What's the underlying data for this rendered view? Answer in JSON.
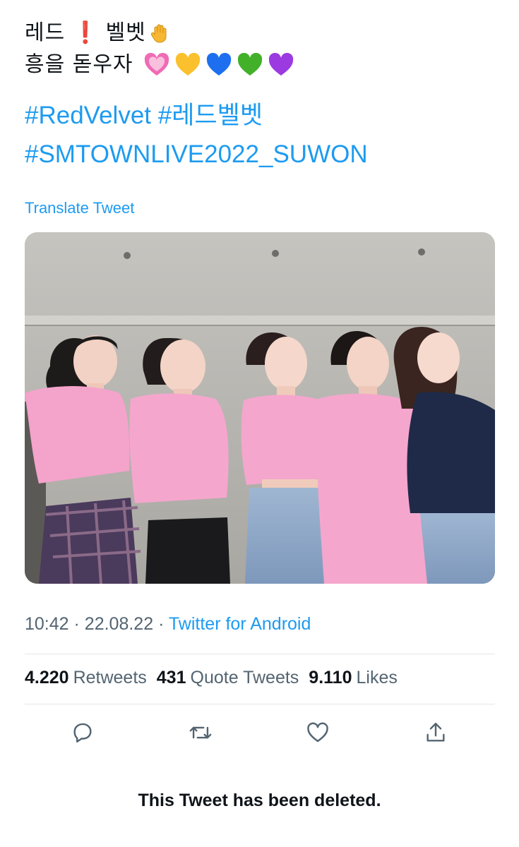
{
  "tweet": {
    "line1_part1": "레드",
    "line1_part2": "벨벳",
    "line2": "흥을 돋우자",
    "hashtags_line1": [
      "#RedVelvet",
      "#레드벨벳"
    ],
    "hashtags_line2": [
      "#SMTOWNLIVE2022_SUWON"
    ],
    "translate_label": "Translate Tweet",
    "emoji": {
      "exclamation": "exclamation-mark-emoji",
      "hand": "raised-hand-emoji",
      "hearts": [
        "pink-heart-emoji",
        "yellow-heart-emoji",
        "blue-heart-emoji",
        "green-heart-emoji",
        "purple-heart-emoji"
      ]
    }
  },
  "photo": {
    "description_icon": "group-photo"
  },
  "meta": {
    "time": "10:42",
    "date": "22.08.22",
    "separator": "·",
    "source": "Twitter for Android"
  },
  "stats": {
    "retweets_count": "4.220",
    "retweets_label": "Retweets",
    "quotes_count": "431",
    "quotes_label": "Quote Tweets",
    "likes_count": "9.110",
    "likes_label": "Likes"
  },
  "actions": {
    "reply": "reply-icon",
    "retweet": "retweet-icon",
    "like": "like-icon",
    "share": "share-icon"
  },
  "colors": {
    "link": "#1d9bf0",
    "text": "#0f1419",
    "secondary": "#536471",
    "divider": "#e2e6e9"
  },
  "deleted_notice": "This Tweet has been deleted."
}
